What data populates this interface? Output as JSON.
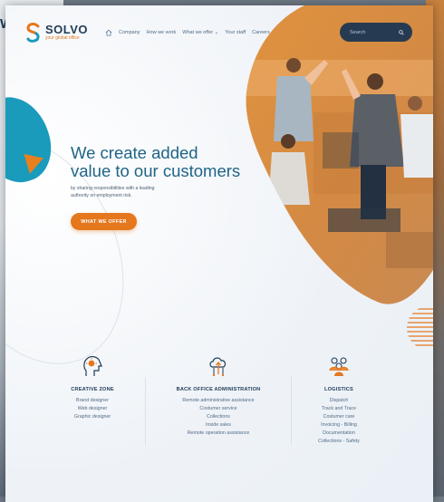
{
  "brand": {
    "name": "SOLVO",
    "tagline": "your global office",
    "colors": {
      "orange": "#e5771d",
      "navy": "#1f3b57",
      "teal": "#1a9bbb",
      "title": "#1f6486"
    }
  },
  "background_page": {
    "partial_text": "W"
  },
  "nav": {
    "home_icon": "home-icon",
    "items": [
      "Company",
      "How we work",
      "What we offer ⌄",
      "Your staff",
      "Careers"
    ]
  },
  "search": {
    "placeholder": "Search",
    "icon": "search-icon"
  },
  "hero": {
    "title_line1": "We create added",
    "title_line2": "value to our customers",
    "subtitle": "by sharing responsibilities with a leading authority on employment risk.",
    "cta": "WHAT WE OFFER"
  },
  "services": [
    {
      "icon": "lightbulb-head-icon",
      "title": "CREATIVE ZONE",
      "items": [
        "Brand designer",
        "Web designer",
        "Graphic designer"
      ]
    },
    {
      "icon": "cloud-upload-icon",
      "title": "BACK OFFICE ADMINISTRATION",
      "items": [
        "Remote administrative assistance",
        "Costumer service",
        "Collections",
        "Inside sales",
        "Remote operation assistance"
      ]
    },
    {
      "icon": "team-icon",
      "title": "LOGISTICS",
      "items": [
        "Dispatch",
        "Track and Trace",
        "Costumer care",
        "Invoicing - Billing",
        "Documentation",
        "Collections - Safety"
      ]
    }
  ]
}
